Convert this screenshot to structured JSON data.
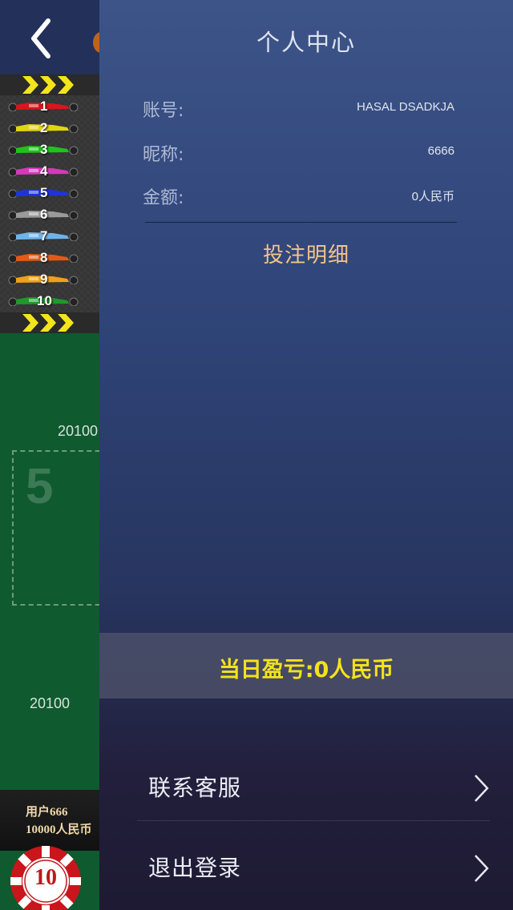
{
  "game": {
    "cars": [
      {
        "number": "1",
        "color": "#d8161c"
      },
      {
        "number": "2",
        "color": "#e2d512"
      },
      {
        "number": "3",
        "color": "#20c21c"
      },
      {
        "number": "4",
        "color": "#d43ab8"
      },
      {
        "number": "5",
        "color": "#1f34d6"
      },
      {
        "number": "6",
        "color": "#9a9a9a"
      },
      {
        "number": "7",
        "color": "#6fb4e8"
      },
      {
        "number": "8",
        "color": "#e25a16"
      },
      {
        "number": "9",
        "color": "#f0a018"
      },
      {
        "number": "10",
        "color": "#1f9a2a"
      }
    ],
    "round_a": "20100",
    "bet_number": "5",
    "round_b": "20100",
    "user_name": "用户666",
    "user_balance": "10000人民币",
    "chip_value": "10"
  },
  "panel": {
    "title": "个人中心",
    "account_label": "账号:",
    "account_value": "HASAL DSADKJA",
    "nickname_label": "昵称:",
    "nickname_value": "6666",
    "amount_label": "金额:",
    "amount_value": "0人民币",
    "bet_detail": "投注明细",
    "daily_pnl": "当日盈亏:0人民币",
    "menu": {
      "service": "联系客服",
      "logout": "退出登录"
    }
  },
  "colors": {
    "accent_gold": "#f2c58a",
    "highlight_yellow": "#f4e21a",
    "felt_green": "#0f5a2f"
  }
}
